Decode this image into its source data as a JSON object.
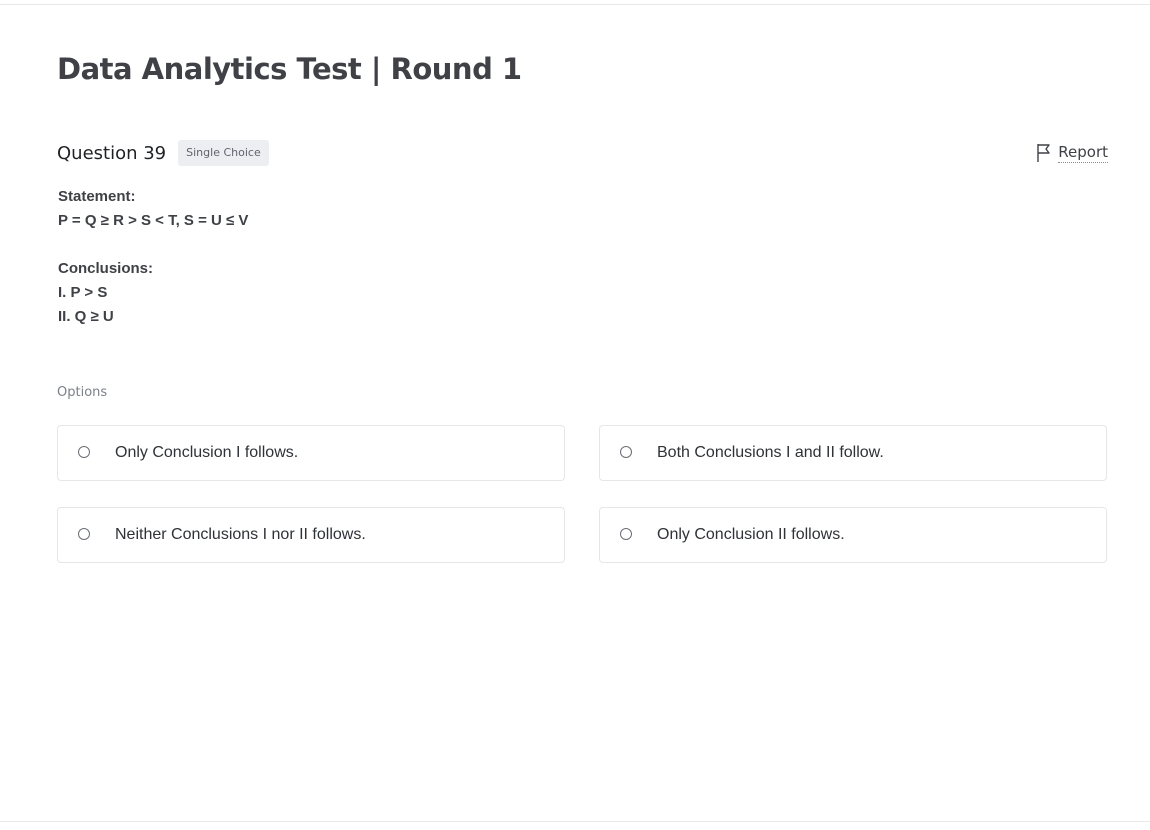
{
  "page": {
    "title": "Data Analytics Test | Round 1"
  },
  "question": {
    "number_label": "Question 39",
    "type_badge": "Single Choice",
    "report_label": "Report",
    "statement_heading": "Statement:",
    "statement_text": "P = Q ≥ R > S < T, S = U ≤ V",
    "conclusions_heading": "Conclusions:",
    "conclusions": [
      "I. P > S",
      "II. Q ≥ U"
    ]
  },
  "options": {
    "heading": "Options",
    "items": [
      {
        "label": "Only Conclusion I follows.",
        "selected": false
      },
      {
        "label": "Both Conclusions I and II follow.",
        "selected": false
      },
      {
        "label": "Neither Conclusions I nor II follows.",
        "selected": false
      },
      {
        "label": "Only Conclusion II follows.",
        "selected": false
      }
    ]
  },
  "icons": {
    "report": "flag-icon",
    "option_radio": "radio-unchecked-icon"
  }
}
